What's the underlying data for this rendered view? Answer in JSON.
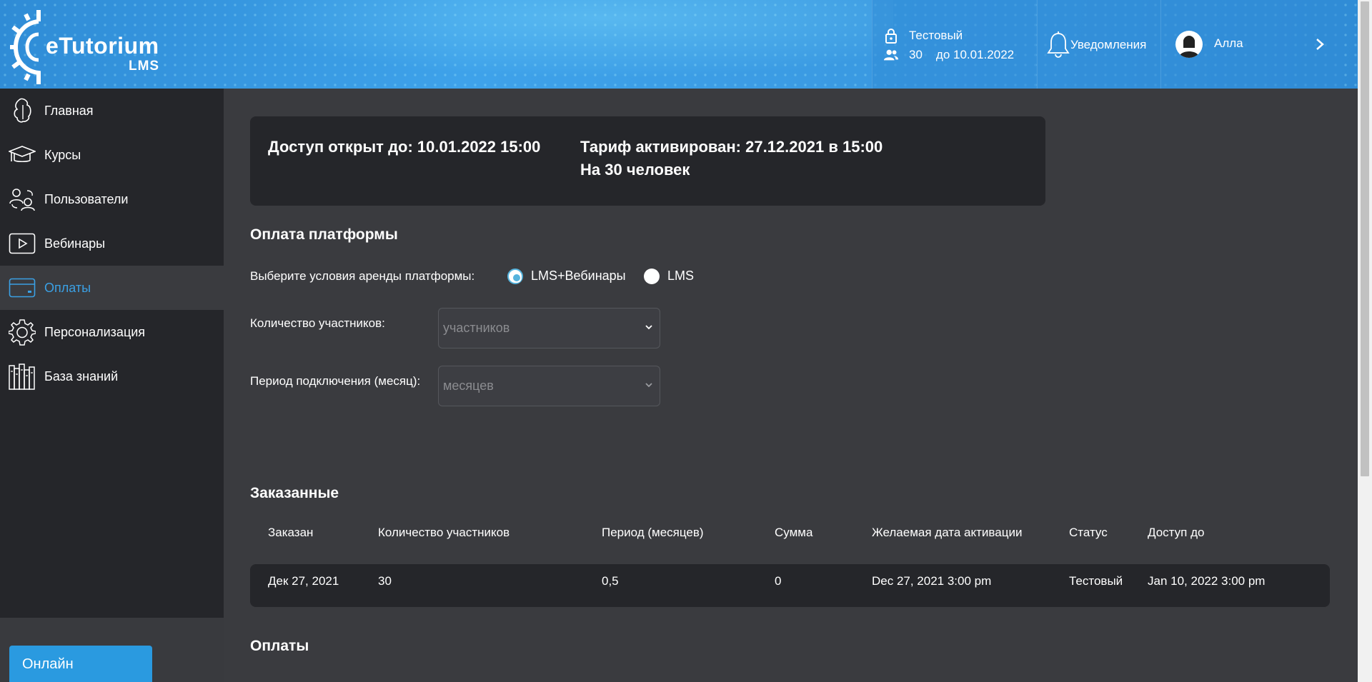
{
  "brand": {
    "name": "eTutorium",
    "sub": "LMS"
  },
  "header": {
    "plan_name": "Тестовый",
    "users_count": "30",
    "valid_until": "до 10.01.2022",
    "notifications_label": "Уведомления",
    "user_name": "Алла"
  },
  "sidebar": {
    "items": [
      {
        "label": "Главная",
        "icon": "home-icon"
      },
      {
        "label": "Курсы",
        "icon": "graduation-cap-icon"
      },
      {
        "label": "Пользователи",
        "icon": "users-icon"
      },
      {
        "label": "Вебинары",
        "icon": "play-icon"
      },
      {
        "label": "Оплаты",
        "icon": "card-icon",
        "active": true
      },
      {
        "label": "Персонализация",
        "icon": "gear-icon"
      },
      {
        "label": "База знаний",
        "icon": "books-icon"
      }
    ],
    "online_label": "Онлайн"
  },
  "access": {
    "open_until": "Доступ открыт до: 10.01.2022  15:00",
    "activated": "Тариф активирован: 27.12.2021  в  15:00",
    "people": "На 30 человек"
  },
  "payment_form": {
    "title": "Оплата платформы",
    "rent_label": "Выберите условия аренды платформы:",
    "options": [
      "LMS+Вебинары",
      "LMS"
    ],
    "selected_option": "LMS+Вебинары",
    "participants_label": "Количество участников:",
    "participants_placeholder": "участников",
    "period_label": "Период подключения (месяц):",
    "period_placeholder": "месяцев"
  },
  "orders": {
    "title": "Заказанные",
    "columns": [
      "Заказан",
      "Количество участников",
      "Период (месяцев)",
      "Сумма",
      "Желаемая дата активации",
      "Статус",
      "Доступ до"
    ],
    "rows": [
      [
        "Дек 27, 2021",
        "30",
        "0,5",
        "0",
        "Dec 27, 2021 3:00 pm",
        "Тестовый",
        "Jan 10, 2022 3:00 pm"
      ]
    ]
  },
  "payments": {
    "title": "Оплаты"
  },
  "colors": {
    "accent": "#3aa0e4",
    "sidebar_bg": "#25262a",
    "main_bg": "#3a3b3f",
    "button": "#2a9ae0"
  }
}
